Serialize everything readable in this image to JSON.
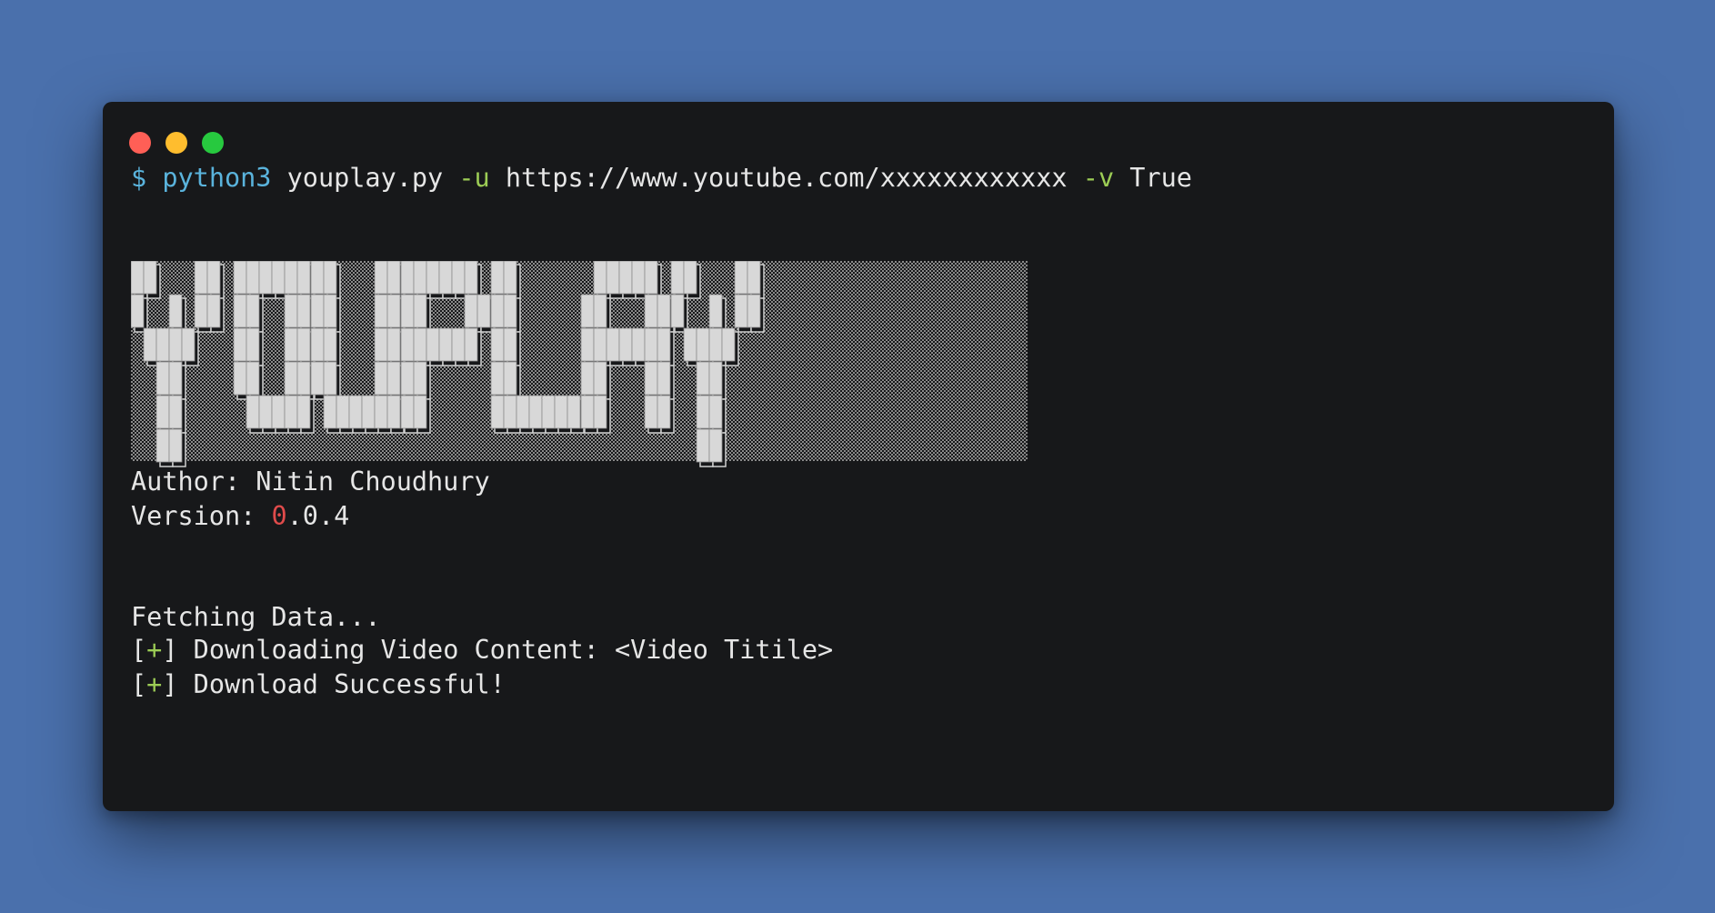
{
  "window": {
    "title_buttons": [
      "close",
      "minimize",
      "maximize"
    ],
    "colors": {
      "close": "#ff5f56",
      "minimize": "#ffbd2e",
      "maximize": "#27c93f",
      "background": "#17181a",
      "desktop": "#4a70ac"
    }
  },
  "command": {
    "prompt": "$",
    "program": "python3",
    "script": "youplay.py",
    "flag_url": "-u",
    "url": "https://www.youtube.com/xxxxxxxxxxxx",
    "flag_verbose": "-v",
    "verbose_value": "True"
  },
  "banner": {
    "text": "YOUPLAY",
    "style": "ANSI shadow block letters",
    "colors": {
      "fill": "#d8d8d8",
      "shadow": "#9a9a9a"
    }
  },
  "info": {
    "author_label": "Author:",
    "author_name": "Nitin Choudhury",
    "version_label": "Version:",
    "version_major": "0",
    "version_rest": ".0.4"
  },
  "output": {
    "fetching": "Fetching Data...",
    "lines": [
      {
        "bracket_open": "[",
        "symbol": "+",
        "bracket_close": "]",
        "text": " Downloading Video Content: <Video Titile>"
      },
      {
        "bracket_open": "[",
        "symbol": "+",
        "bracket_close": "]",
        "text": " Download Successful!"
      }
    ]
  }
}
